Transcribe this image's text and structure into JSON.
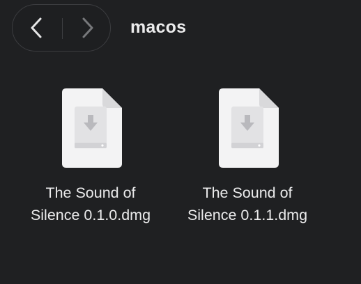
{
  "window": {
    "title": "macos"
  },
  "toolbar": {
    "back_icon": "chevron-left-icon",
    "forward_icon": "chevron-right-icon"
  },
  "files": [
    {
      "name_line1": "The Sound of",
      "name_line2": "Silence 0.1.0.dmg",
      "icon": "dmg-file-icon"
    },
    {
      "name_line1": "The Sound of",
      "name_line2": "Silence 0.1.1.dmg",
      "icon": "dmg-file-icon"
    }
  ],
  "colors": {
    "background": "#1f2022",
    "text": "#ebebec",
    "border": "#3c3d40",
    "icon_fill": "#f4f4f5"
  }
}
